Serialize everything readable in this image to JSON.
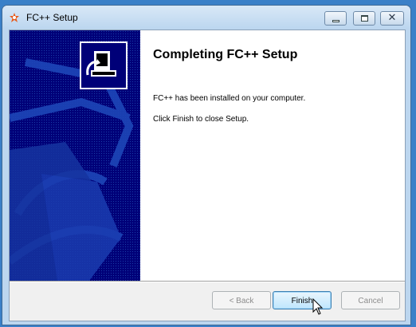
{
  "window": {
    "title": "FC++ Setup",
    "controls": {
      "minimize_icon": "minimize-icon",
      "maximize_icon": "maximize-icon",
      "close_icon": "close-icon",
      "close_glyph": "✕"
    }
  },
  "content": {
    "heading": "Completing FC++ Setup",
    "paragraphs": [
      "FC++ has been installed on your computer.",
      "Click Finish to close Setup."
    ]
  },
  "buttons": {
    "back": {
      "label": "< Back",
      "enabled": false
    },
    "finish": {
      "label": "Finish",
      "enabled": true
    },
    "cancel": {
      "label": "Cancel",
      "enabled": false
    }
  },
  "colors": {
    "side_panel": "#000078",
    "desktop": "#3a80c8"
  }
}
